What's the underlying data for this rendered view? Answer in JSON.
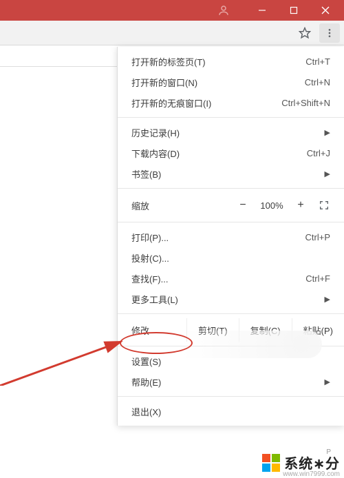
{
  "titlebar": {
    "avatar": "person",
    "minimize": "min",
    "maximize": "max",
    "close": "close"
  },
  "toolbar": {
    "star": "bookmark",
    "menu": "menu"
  },
  "menu": {
    "new_tab": {
      "label": "打开新的标签页(T)",
      "shortcut": "Ctrl+T"
    },
    "new_window": {
      "label": "打开新的窗口(N)",
      "shortcut": "Ctrl+N"
    },
    "new_incognito": {
      "label": "打开新的无痕窗口(I)",
      "shortcut": "Ctrl+Shift+N"
    },
    "history": {
      "label": "历史记录(H)"
    },
    "downloads": {
      "label": "下载内容(D)",
      "shortcut": "Ctrl+J"
    },
    "bookmarks": {
      "label": "书签(B)"
    },
    "zoom": {
      "label": "缩放",
      "minus": "−",
      "value": "100%",
      "plus": "+"
    },
    "print": {
      "label": "打印(P)...",
      "shortcut": "Ctrl+P"
    },
    "cast": {
      "label": "投射(C)..."
    },
    "find": {
      "label": "查找(F)...",
      "shortcut": "Ctrl+F"
    },
    "more_tools": {
      "label": "更多工具(L)"
    },
    "edit": {
      "label": "修改",
      "cut": "剪切(T)",
      "copy": "复制(C)",
      "paste": "粘贴(P)"
    },
    "settings": {
      "label": "设置(S)"
    },
    "help": {
      "label": "帮助(E)"
    },
    "exit": {
      "label": "退出(X)"
    }
  },
  "watermark": {
    "sub": "P",
    "url": "www.win7999.com",
    "text": "系统∗分",
    "logo_colors": {
      "r": "#f25022",
      "g": "#7fba00",
      "b": "#00a4ef",
      "y": "#ffb900"
    }
  }
}
